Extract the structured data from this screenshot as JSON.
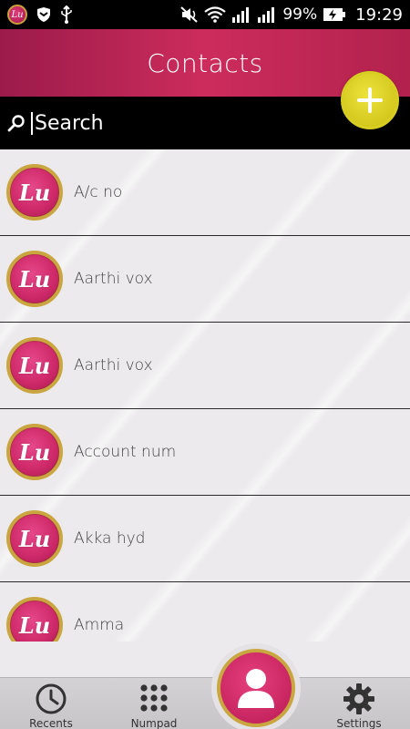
{
  "status_bar": {
    "app_badge": "Lu",
    "battery": "99%",
    "time": "19:29"
  },
  "header": {
    "title": "Contacts"
  },
  "search": {
    "placeholder": "Search"
  },
  "avatar_text": "Lu",
  "contacts": [
    {
      "name": "A/c no"
    },
    {
      "name": "Aarthi vox"
    },
    {
      "name": "Aarthi vox"
    },
    {
      "name": "Account num"
    },
    {
      "name": "Akka hyd"
    },
    {
      "name": "Amma"
    }
  ],
  "nav": {
    "recents": "Recents",
    "numpad": "Numpad",
    "settings": "Settings"
  },
  "colors": {
    "header_start": "#9b1b4a",
    "header_mid": "#cc2c5c",
    "add_button": "#e2d82a",
    "avatar_pink": "#cf2a6a",
    "avatar_ring": "#c9a640"
  }
}
